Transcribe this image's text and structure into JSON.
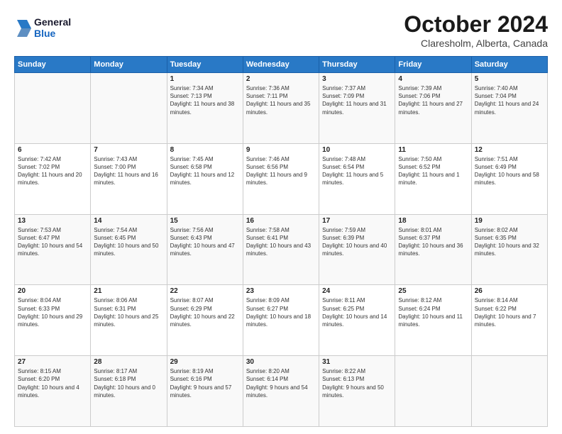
{
  "header": {
    "logo_general": "General",
    "logo_blue": "Blue",
    "month": "October 2024",
    "location": "Claresholm, Alberta, Canada"
  },
  "days_of_week": [
    "Sunday",
    "Monday",
    "Tuesday",
    "Wednesday",
    "Thursday",
    "Friday",
    "Saturday"
  ],
  "weeks": [
    [
      {
        "day": "",
        "info": ""
      },
      {
        "day": "",
        "info": ""
      },
      {
        "day": "1",
        "info": "Sunrise: 7:34 AM\nSunset: 7:13 PM\nDaylight: 11 hours and 38 minutes."
      },
      {
        "day": "2",
        "info": "Sunrise: 7:36 AM\nSunset: 7:11 PM\nDaylight: 11 hours and 35 minutes."
      },
      {
        "day": "3",
        "info": "Sunrise: 7:37 AM\nSunset: 7:09 PM\nDaylight: 11 hours and 31 minutes."
      },
      {
        "day": "4",
        "info": "Sunrise: 7:39 AM\nSunset: 7:06 PM\nDaylight: 11 hours and 27 minutes."
      },
      {
        "day": "5",
        "info": "Sunrise: 7:40 AM\nSunset: 7:04 PM\nDaylight: 11 hours and 24 minutes."
      }
    ],
    [
      {
        "day": "6",
        "info": "Sunrise: 7:42 AM\nSunset: 7:02 PM\nDaylight: 11 hours and 20 minutes."
      },
      {
        "day": "7",
        "info": "Sunrise: 7:43 AM\nSunset: 7:00 PM\nDaylight: 11 hours and 16 minutes."
      },
      {
        "day": "8",
        "info": "Sunrise: 7:45 AM\nSunset: 6:58 PM\nDaylight: 11 hours and 12 minutes."
      },
      {
        "day": "9",
        "info": "Sunrise: 7:46 AM\nSunset: 6:56 PM\nDaylight: 11 hours and 9 minutes."
      },
      {
        "day": "10",
        "info": "Sunrise: 7:48 AM\nSunset: 6:54 PM\nDaylight: 11 hours and 5 minutes."
      },
      {
        "day": "11",
        "info": "Sunrise: 7:50 AM\nSunset: 6:52 PM\nDaylight: 11 hours and 1 minute."
      },
      {
        "day": "12",
        "info": "Sunrise: 7:51 AM\nSunset: 6:49 PM\nDaylight: 10 hours and 58 minutes."
      }
    ],
    [
      {
        "day": "13",
        "info": "Sunrise: 7:53 AM\nSunset: 6:47 PM\nDaylight: 10 hours and 54 minutes."
      },
      {
        "day": "14",
        "info": "Sunrise: 7:54 AM\nSunset: 6:45 PM\nDaylight: 10 hours and 50 minutes."
      },
      {
        "day": "15",
        "info": "Sunrise: 7:56 AM\nSunset: 6:43 PM\nDaylight: 10 hours and 47 minutes."
      },
      {
        "day": "16",
        "info": "Sunrise: 7:58 AM\nSunset: 6:41 PM\nDaylight: 10 hours and 43 minutes."
      },
      {
        "day": "17",
        "info": "Sunrise: 7:59 AM\nSunset: 6:39 PM\nDaylight: 10 hours and 40 minutes."
      },
      {
        "day": "18",
        "info": "Sunrise: 8:01 AM\nSunset: 6:37 PM\nDaylight: 10 hours and 36 minutes."
      },
      {
        "day": "19",
        "info": "Sunrise: 8:02 AM\nSunset: 6:35 PM\nDaylight: 10 hours and 32 minutes."
      }
    ],
    [
      {
        "day": "20",
        "info": "Sunrise: 8:04 AM\nSunset: 6:33 PM\nDaylight: 10 hours and 29 minutes."
      },
      {
        "day": "21",
        "info": "Sunrise: 8:06 AM\nSunset: 6:31 PM\nDaylight: 10 hours and 25 minutes."
      },
      {
        "day": "22",
        "info": "Sunrise: 8:07 AM\nSunset: 6:29 PM\nDaylight: 10 hours and 22 minutes."
      },
      {
        "day": "23",
        "info": "Sunrise: 8:09 AM\nSunset: 6:27 PM\nDaylight: 10 hours and 18 minutes."
      },
      {
        "day": "24",
        "info": "Sunrise: 8:11 AM\nSunset: 6:25 PM\nDaylight: 10 hours and 14 minutes."
      },
      {
        "day": "25",
        "info": "Sunrise: 8:12 AM\nSunset: 6:24 PM\nDaylight: 10 hours and 11 minutes."
      },
      {
        "day": "26",
        "info": "Sunrise: 8:14 AM\nSunset: 6:22 PM\nDaylight: 10 hours and 7 minutes."
      }
    ],
    [
      {
        "day": "27",
        "info": "Sunrise: 8:15 AM\nSunset: 6:20 PM\nDaylight: 10 hours and 4 minutes."
      },
      {
        "day": "28",
        "info": "Sunrise: 8:17 AM\nSunset: 6:18 PM\nDaylight: 10 hours and 0 minutes."
      },
      {
        "day": "29",
        "info": "Sunrise: 8:19 AM\nSunset: 6:16 PM\nDaylight: 9 hours and 57 minutes."
      },
      {
        "day": "30",
        "info": "Sunrise: 8:20 AM\nSunset: 6:14 PM\nDaylight: 9 hours and 54 minutes."
      },
      {
        "day": "31",
        "info": "Sunrise: 8:22 AM\nSunset: 6:13 PM\nDaylight: 9 hours and 50 minutes."
      },
      {
        "day": "",
        "info": ""
      },
      {
        "day": "",
        "info": ""
      }
    ]
  ]
}
